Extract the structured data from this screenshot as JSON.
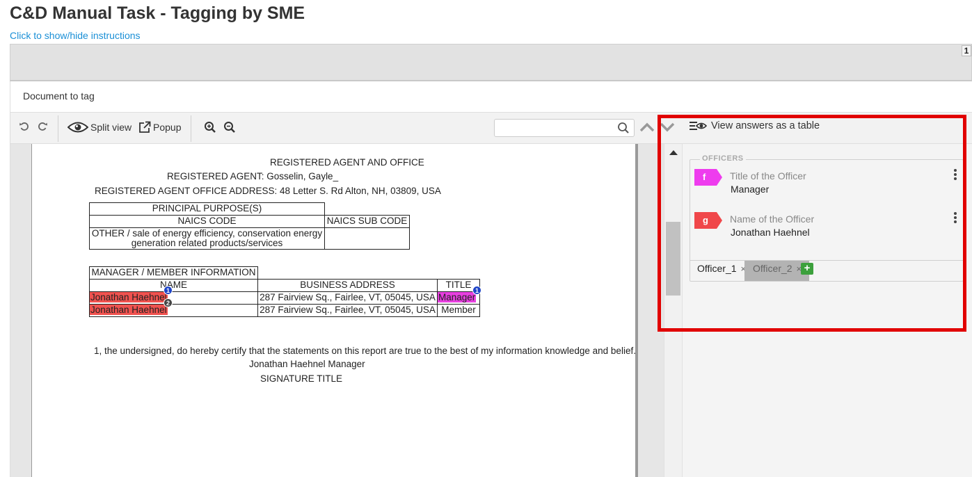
{
  "header": {
    "title": "C&D Manual Task - Tagging by SME",
    "instructions_link": "Click to show/hide instructions",
    "page_indicator": "1"
  },
  "doc_section_label": "Document to tag",
  "toolbar": {
    "undo_icon": "undo-icon",
    "redo_icon": "redo-icon",
    "split_view_label": "Split view",
    "popup_label": "Popup",
    "zoom_in_icon": "zoom-in-icon",
    "zoom_out_icon": "zoom-out-icon",
    "search_value": "",
    "search_placeholder": ""
  },
  "document": {
    "heading": "REGISTERED AGENT AND OFFICE",
    "agent": "REGISTERED AGENT: Gosselin, Gayle_",
    "agent_address": "REGISTERED AGENT OFFICE ADDRESS: 48 Letter S. Rd Alton, NH, 03809, USA",
    "purpose_table": {
      "title": "PRINCIPAL PURPOSE(S)",
      "col1": "NAICS CODE",
      "col2": "NAICS SUB CODE",
      "row1_line1": "OTHER / sale of energy efficiency, conservation energy",
      "row1_line2": "generation related products/services"
    },
    "manager_table": {
      "title": "MANAGER / MEMBER INFORMATION",
      "col_name": "NAME",
      "col_address": "BUSINESS ADDRESS",
      "col_title": "TITLE",
      "rows": [
        {
          "name": "Jonathan Haehnel",
          "address": "287 Fairview Sq., Fairlee, VT, 05045, USA",
          "title": "Manager",
          "name_badge": "1",
          "title_badge": "1"
        },
        {
          "name": "Jonathan Haehnel",
          "address": "287 Fairview Sq., Fairlee, VT, 05045, USA",
          "title": "Member",
          "name_badge": "2"
        }
      ]
    },
    "certify": "1, the undersigned, do hereby certify that the statements on this report are true to the best of my information knowledge and belief.",
    "signer": "Jonathan Haehnel Manager",
    "signature_title": "SIGNATURE TITLE"
  },
  "answers_panel": {
    "view_table_label": "View answers as a table",
    "group_label": "OFFICERS",
    "answers": [
      {
        "tag": "f",
        "label": "Title of the Officer",
        "value": "Manager",
        "color": "#ee3cee"
      },
      {
        "tag": "g",
        "label": "Name of the Officer",
        "value": "Jonathan Haehnel",
        "color": "#f0474a"
      }
    ],
    "tabs": [
      {
        "label": "Officer_1",
        "close": "×"
      },
      {
        "label": "Officer_2",
        "close": "×"
      }
    ],
    "add_label": "+"
  },
  "colors": {
    "highlight_red": "#f0524f",
    "highlight_pink": "#e83fe0",
    "annotation_box": "#e10000",
    "link": "#1a8fd6"
  }
}
